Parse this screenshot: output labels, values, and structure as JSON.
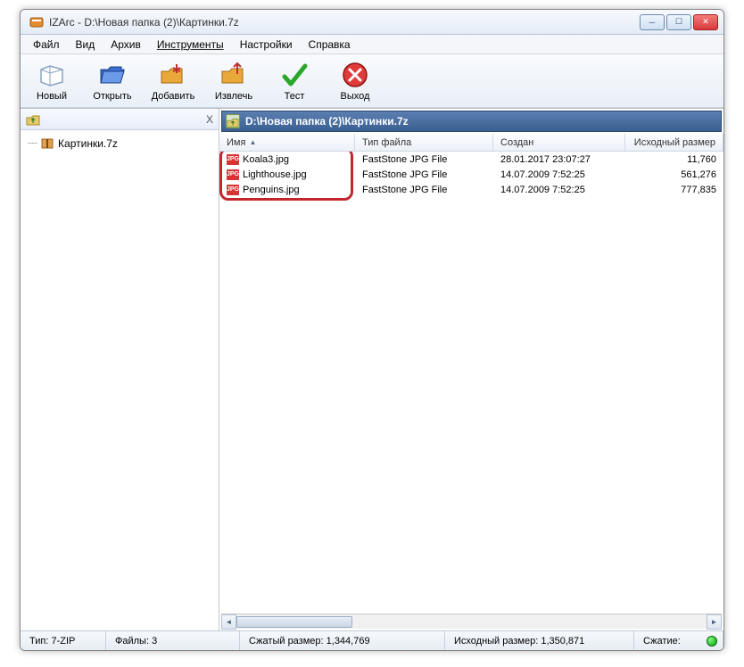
{
  "title": "IZArc - D:\\Новая папка (2)\\Картинки.7z",
  "menu": {
    "file": "Файл",
    "view": "Вид",
    "archive": "Архив",
    "tools": "Инструменты",
    "settings": "Настройки",
    "help": "Справка"
  },
  "toolbar": {
    "new": "Новый",
    "open": "Открыть",
    "add": "Добавить",
    "extract": "Извлечь",
    "test": "Тест",
    "exit": "Выход"
  },
  "tree": {
    "close": "X",
    "root": "Картинки.7z"
  },
  "path": "D:\\Новая папка (2)\\Картинки.7z",
  "columns": {
    "name": "Имя",
    "type": "Тип файла",
    "created": "Создан",
    "size": "Исходный размер"
  },
  "rows": [
    {
      "name": "Koala3.jpg",
      "type": "FastStone JPG File",
      "created": "28.01.2017 23:07:27",
      "size": "11,760"
    },
    {
      "name": "Lighthouse.jpg",
      "type": "FastStone JPG File",
      "created": "14.07.2009 7:52:25",
      "size": "561,276"
    },
    {
      "name": "Penguins.jpg",
      "type": "FastStone JPG File",
      "created": "14.07.2009 7:52:25",
      "size": "777,835"
    }
  ],
  "status": {
    "type_label": "Тип:",
    "type": "7-ZIP",
    "files_label": "Файлы:",
    "files": "3",
    "packed_label": "Сжатый размер:",
    "packed": "1,344,769",
    "orig_label": "Исходный размер:",
    "orig": "1,350,871",
    "ratio_label": "Сжатие:"
  }
}
